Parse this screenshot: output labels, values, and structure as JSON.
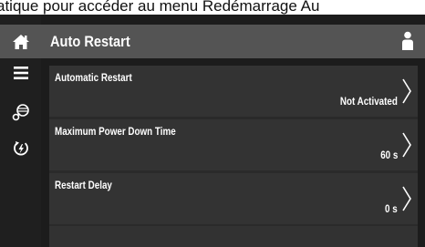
{
  "caption": "atique pour accéder au menu Redémarrage Au",
  "header": {
    "title": "Auto Restart"
  },
  "sidebar": {
    "items": [
      {
        "icon": "home-icon"
      },
      {
        "icon": "menu-icon"
      },
      {
        "icon": "compressor-icon"
      },
      {
        "icon": "power-restart-icon"
      }
    ]
  },
  "settings": {
    "rows": [
      {
        "label": "Automatic Restart",
        "value": "Not Activated"
      },
      {
        "label": "Maximum Power Down Time",
        "value": "60 s"
      },
      {
        "label": "Restart Delay",
        "value": "0 s"
      }
    ]
  },
  "colors": {
    "header_bg": "#545454",
    "screen_bg": "#1c1c1c",
    "row_bg": "#333333",
    "text": "#ffffff"
  }
}
